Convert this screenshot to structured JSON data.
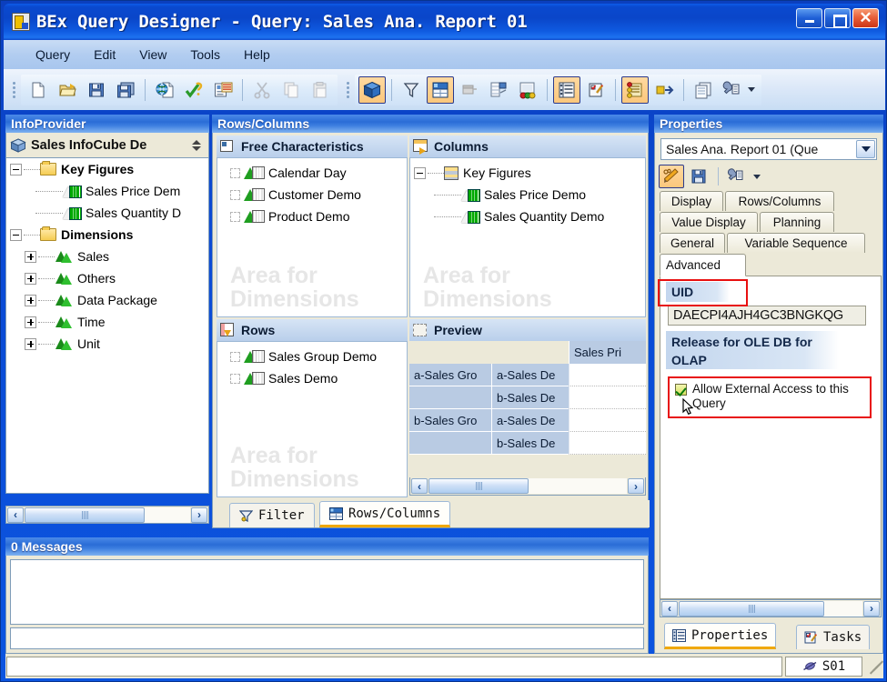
{
  "window": {
    "title": "BEx Query Designer - Query: Sales Ana. Report 01",
    "minimize_label": "_",
    "maximize_label": "□",
    "close_label": "✕"
  },
  "menu": {
    "items": [
      "Query",
      "Edit",
      "View",
      "Tools",
      "Help"
    ]
  },
  "toolbar": {
    "group1": [
      {
        "name": "new-query-icon",
        "title": "New Query"
      },
      {
        "name": "open-query-icon",
        "title": "Open Query"
      },
      {
        "name": "save-query-icon",
        "title": "Save Query"
      },
      {
        "name": "save-as-query-icon",
        "title": "Save As"
      },
      {
        "name": "publish-web-icon",
        "title": "Publish"
      },
      {
        "name": "check-query-icon",
        "title": "Check Query"
      },
      {
        "name": "query-properties-icon",
        "title": "Query Properties"
      },
      {
        "name": "cut-icon",
        "title": "Cut"
      },
      {
        "name": "copy-icon",
        "title": "Copy"
      },
      {
        "name": "paste-icon",
        "title": "Paste"
      }
    ],
    "group2": [
      {
        "name": "infoprovider-cube-icon",
        "title": "InfoProvider",
        "active": true
      },
      {
        "name": "filter-funnel-icon",
        "title": "Filter"
      },
      {
        "name": "rows-columns-grid-icon",
        "title": "Rows/Columns",
        "active": true
      },
      {
        "name": "cell-definition-icon",
        "title": "Cells"
      },
      {
        "name": "exceptions-icon",
        "title": "Exceptions"
      },
      {
        "name": "conditions-icon",
        "title": "Conditions"
      },
      {
        "name": "properties-list-icon",
        "title": "Properties",
        "active": true
      },
      {
        "name": "tasks-checklist-icon",
        "title": "Tasks"
      },
      {
        "name": "messages-scroll-icon",
        "title": "Messages",
        "active": true
      },
      {
        "name": "export-arrow-icon",
        "title": "Export"
      },
      {
        "name": "documents-icon",
        "title": "Documents"
      },
      {
        "name": "settings-wrench-icon",
        "title": "Settings"
      }
    ]
  },
  "infoprovider": {
    "panel_title": "InfoProvider",
    "cube_name": "Sales InfoCube De",
    "sort_icon": "sort-updown-icon",
    "tree": [
      {
        "label": "Key Figures",
        "icon": "folder-icon",
        "level": 0,
        "toggle": "minus",
        "bold": true
      },
      {
        "label": "Sales Price Dem",
        "icon": "key-figure-icon",
        "level": 1,
        "toggle": "none",
        "bold": false
      },
      {
        "label": "Sales Quantity D",
        "icon": "key-figure-icon",
        "level": 1,
        "toggle": "none",
        "bold": false
      },
      {
        "label": "Dimensions",
        "icon": "folder-icon",
        "level": 0,
        "toggle": "minus",
        "bold": true
      },
      {
        "label": "Sales",
        "icon": "dimension-icon",
        "level": 1,
        "toggle": "plus",
        "bold": false
      },
      {
        "label": "Others",
        "icon": "dimension-icon",
        "level": 1,
        "toggle": "plus",
        "bold": false
      },
      {
        "label": "Data Package",
        "icon": "dimension-icon",
        "level": 1,
        "toggle": "plus",
        "bold": false
      },
      {
        "label": "Time",
        "icon": "dimension-icon",
        "level": 1,
        "toggle": "plus",
        "bold": false
      },
      {
        "label": "Unit",
        "icon": "dimension-icon",
        "level": 1,
        "toggle": "plus",
        "bold": false
      }
    ],
    "scroll_left_label": "‹",
    "scroll_right_label": "›"
  },
  "rowscolumns": {
    "panel_title": "Rows/Columns",
    "free_characteristics": {
      "title": "Free Characteristics",
      "icon": "free-characteristics-icon",
      "watermark": "Area for\nDimensions",
      "watermark_line1": "Area for",
      "watermark_line2": "Dimensions",
      "items": [
        "Calendar Day",
        "Customer Demo",
        "Product Demo"
      ]
    },
    "columns": {
      "title": "Columns",
      "icon": "columns-icon",
      "watermark_line1": "Area for",
      "watermark_line2": "Dimensions",
      "root": "Key Figures",
      "items": [
        "Sales Price Demo",
        "Sales Quantity Demo"
      ]
    },
    "rows": {
      "title": "Rows",
      "icon": "rows-icon",
      "watermark_line1": "Area for",
      "watermark_line2": "Dimensions",
      "items": [
        "Sales Group Demo",
        "Sales Demo"
      ]
    },
    "preview": {
      "title": "Preview",
      "icon": "preview-icon",
      "column_header": "Sales Pri",
      "rows": [
        {
          "group": "a-Sales Gro",
          "member": "a-Sales De",
          "value": ""
        },
        {
          "group": "",
          "member": "b-Sales De",
          "value": ""
        },
        {
          "group": "b-Sales Gro",
          "member": "a-Sales De",
          "value": ""
        },
        {
          "group": "",
          "member": "b-Sales De",
          "value": ""
        }
      ],
      "scroll_left_label": "‹",
      "scroll_right_label": "›"
    },
    "tabs": [
      {
        "label": "Filter",
        "icon": "filter-funnel-icon",
        "selected": false
      },
      {
        "label": "Rows/Columns",
        "icon": "rows-columns-grid-icon",
        "selected": true
      }
    ]
  },
  "messages": {
    "panel_title": "0 Messages",
    "items": []
  },
  "properties": {
    "panel_title": "Properties",
    "combo_value": "Sales Ana. Report 01 (Que",
    "combo_arrow_icon": "chevron-down-icon",
    "toolbar": [
      {
        "name": "edit-pencil-icon",
        "active": true
      },
      {
        "name": "save-disk-icon",
        "active": false
      },
      {
        "name": "settings-wrench-icon",
        "active": false
      }
    ],
    "tabs": [
      {
        "label": "Display",
        "selected": false
      },
      {
        "label": "Rows/Columns",
        "selected": false
      },
      {
        "label": "Value Display",
        "selected": false
      },
      {
        "label": "Planning",
        "selected": false
      },
      {
        "label": "General",
        "selected": false
      },
      {
        "label": "Variable Sequence",
        "selected": false
      },
      {
        "label": "Advanced",
        "selected": true
      }
    ],
    "uid_group_label": "UID",
    "uid_value": "DAECPI4AJH4GC3BNGKQG",
    "ole_group_label": "Release for OLE DB for OLAP",
    "allow_access_label": "Allow External Access to this Query",
    "allow_access_checked": true,
    "highlight_color": "#e81010",
    "scroll_left_label": "‹",
    "scroll_right_label": "›",
    "bottom_tabs": [
      {
        "label": "Properties",
        "icon": "properties-list-icon",
        "selected": true
      },
      {
        "label": "Tasks",
        "icon": "tasks-checklist-icon",
        "selected": false
      }
    ]
  },
  "statusbar": {
    "left_text": "",
    "system_label": "S01",
    "system_icon": "connection-icon",
    "grip_icon": "resize-grip-icon"
  },
  "colors": {
    "titlebar_blue": "#0a49cf",
    "panel_header_blue": "#2a6cd6",
    "panel_bg": "#ece9d8",
    "accent_orange": "#f0a800",
    "highlight_red": "#e81010",
    "selected_toolbar": "#fbc77c"
  }
}
